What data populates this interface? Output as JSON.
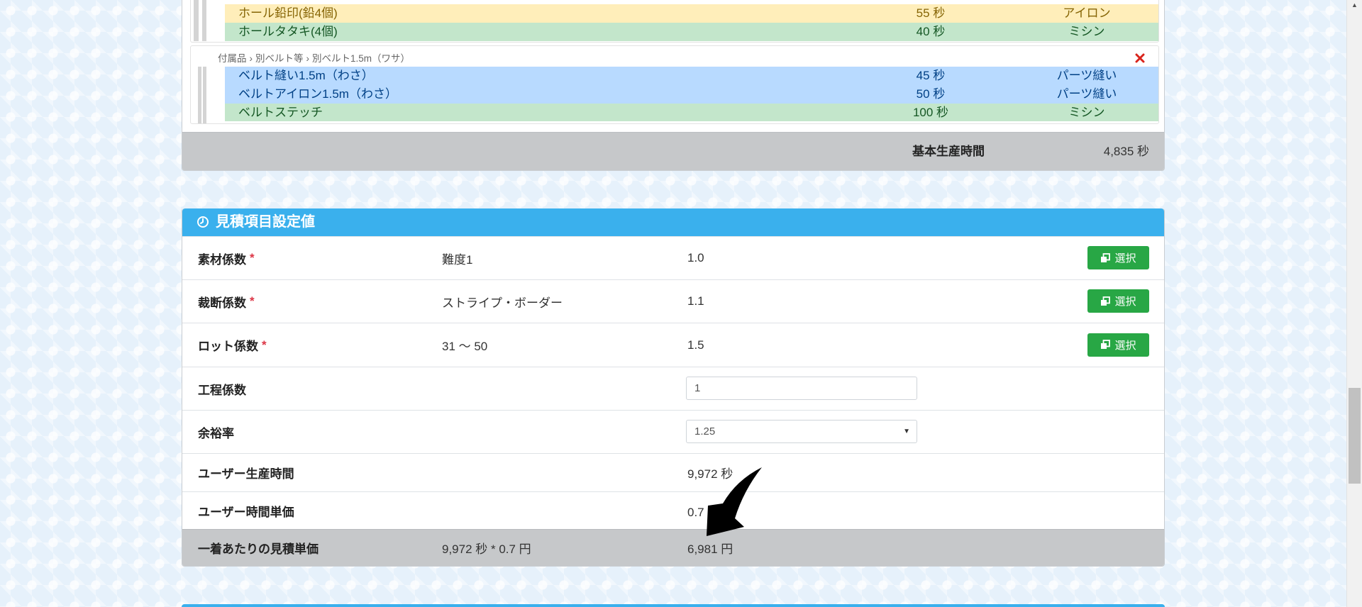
{
  "colors": {
    "background": "#e6f1fb",
    "panel_header": "#3ab0ed",
    "row_warning": "#ffeeba",
    "row_success": "#c3e6cb",
    "row_primary": "#b8daff",
    "footer": "#c6c8ca",
    "button_success": "#28a745",
    "required": "#dc3545",
    "remove": "#d9241c",
    "annotation_arrow": "#000000"
  },
  "icons": {
    "remove": "close-icon",
    "panel_header": "clock-icon",
    "select_button": "clone-icon",
    "select_caret": "caret-down-icon",
    "scroll_up": "scroll-up-arrow-icon"
  },
  "process_list": {
    "group1": {
      "rows": [
        {
          "name": "ホール鉛印(鉛4個)",
          "time": "55 秒",
          "type": "アイロン"
        },
        {
          "name": "ホールタタキ(4個)",
          "time": "40 秒",
          "type": "ミシン"
        }
      ]
    },
    "group2": {
      "breadcrumb": [
        "付属品",
        "別ベルト等",
        "別ベルト1.5m（ワサ）"
      ],
      "separator": "›",
      "rows": [
        {
          "name": "ベルト縫い1.5m（わさ）",
          "time": "45 秒",
          "type": "パーツ縫い"
        },
        {
          "name": "ベルトアイロン1.5m（わさ）",
          "time": "50 秒",
          "type": "パーツ縫い"
        },
        {
          "name": "ベルトステッチ",
          "time": "100 秒",
          "type": "ミシン"
        }
      ]
    },
    "total": {
      "label": "基本生産時間",
      "value": "4,835 秒"
    }
  },
  "estimate": {
    "title": "見積項目設定値",
    "required_mark": "*",
    "select_button_label": "選択",
    "rows": [
      {
        "label": "素材係数",
        "selection": "難度1",
        "value": "1.0"
      },
      {
        "label": "裁断係数",
        "selection": "ストライプ・ボーダー",
        "value": "1.1"
      },
      {
        "label": "ロット係数",
        "selection": "31 〜 50",
        "value": "1.5"
      },
      {
        "label": "工程係数",
        "input_value": "1"
      },
      {
        "label": "余裕率",
        "select_value": "1.25"
      },
      {
        "label": "ユーザー生産時間",
        "value": "9,972 秒"
      },
      {
        "label": "ユーザー時間単価",
        "value": "0.7 円"
      }
    ],
    "footer": {
      "label": "一着あたりの見積単価",
      "formula": "9,972 秒 * 0.7 円",
      "value": "6,981 円"
    }
  }
}
